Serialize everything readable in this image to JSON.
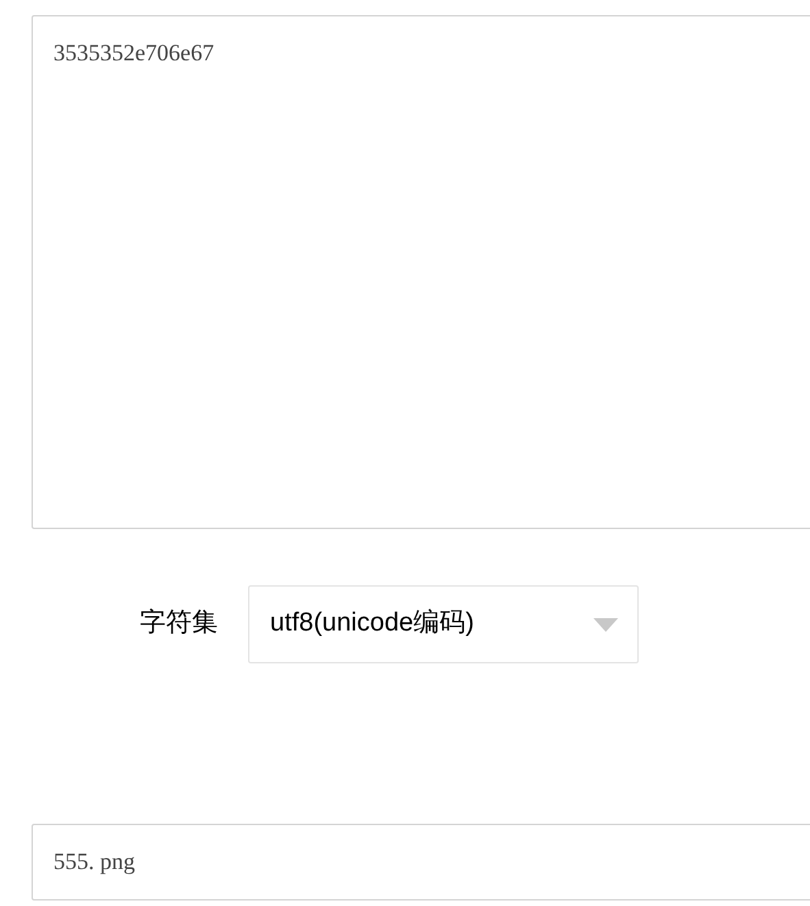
{
  "hex_output": {
    "value": "3535352e706e67"
  },
  "charset": {
    "label": "字符集",
    "value": "utf8(unicode编码)"
  },
  "text_output": {
    "value": "555. png"
  }
}
